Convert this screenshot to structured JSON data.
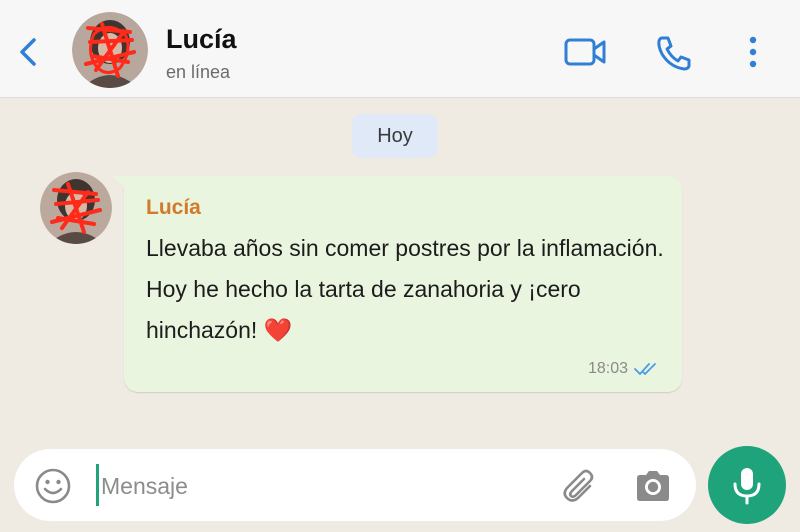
{
  "header": {
    "contact_name": "Lucía",
    "status": "en línea",
    "icons": [
      "back-icon",
      "video-call-icon",
      "phone-icon",
      "more-options-icon"
    ]
  },
  "chat": {
    "date_label": "Hoy",
    "messages": [
      {
        "sender": "Lucía",
        "text": "Llevaba años sin comer postres por la inflamación. Hoy he hecho la tarta de zanahoria y ¡cero hinchazón! ❤️",
        "time": "18:03",
        "status_icon": "double-check-icon"
      }
    ]
  },
  "composer": {
    "placeholder": "Mensaje",
    "icons": [
      "emoji-icon",
      "paperclip-icon",
      "camera-icon",
      "microphone-icon"
    ]
  },
  "colors": {
    "accent": "#1fa37a",
    "header_icons": "#2f7fd6",
    "sender_name": "#d07a2a",
    "bubble": "#eaf5e0",
    "date_pill": "#dfe9f7"
  }
}
